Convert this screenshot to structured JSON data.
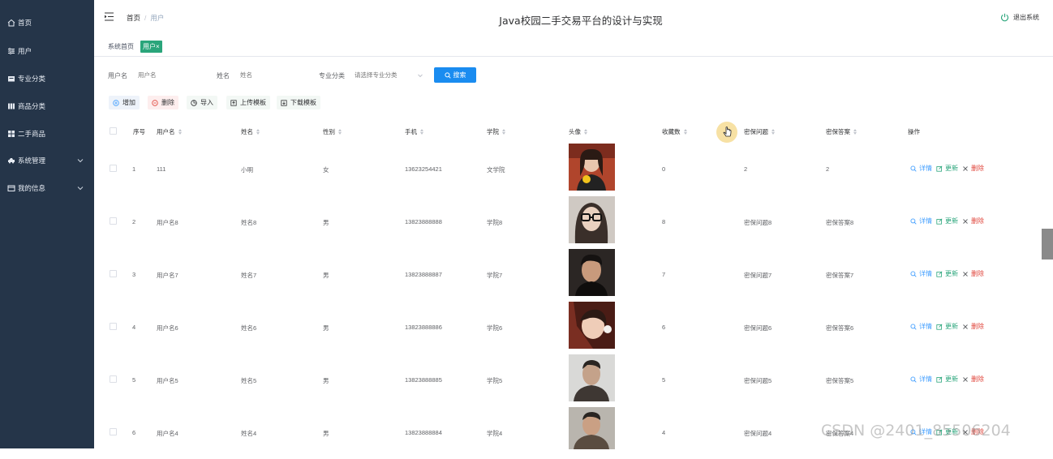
{
  "sidebar": {
    "items": [
      {
        "label": "首页",
        "icon": "home-icon"
      },
      {
        "label": "用户",
        "icon": "filter-icon"
      },
      {
        "label": "专业分类",
        "icon": "folder-icon"
      },
      {
        "label": "商品分类",
        "icon": "grid-icon"
      },
      {
        "label": "二手商品",
        "icon": "apps-icon"
      },
      {
        "label": "系统管理",
        "icon": "car-icon"
      },
      {
        "label": "我的信息",
        "icon": "card-icon"
      }
    ]
  },
  "header": {
    "breadcrumb_home": "首页",
    "breadcrumb_sep": "/",
    "breadcrumb_current": "用户",
    "title": "Java校园二手交易平台的设计与实现",
    "logout": "退出系统"
  },
  "tags": {
    "home": "系统首页",
    "active": "用户",
    "close": "×"
  },
  "search": {
    "username_label": "用户名",
    "username_placeholder": "用户名",
    "name_label": "姓名",
    "name_placeholder": "姓名",
    "major_label": "专业分类",
    "major_placeholder": "请选择专业分类",
    "button": "搜索"
  },
  "actions": {
    "add": "增加",
    "delete": "删除",
    "import": "导入",
    "upload": "上传模板",
    "download": "下载模板"
  },
  "table": {
    "headers": {
      "index": "序号",
      "username": "用户名",
      "name": "姓名",
      "gender": "性别",
      "phone": "手机",
      "college": "学院",
      "avatar": "头像",
      "favorites": "收藏数",
      "question": "密保问题",
      "answer": "密保答案",
      "ops": "操作"
    },
    "op_labels": {
      "detail": "详情",
      "update": "更新",
      "delete": "删除"
    },
    "rows": [
      {
        "index": "1",
        "username": "111",
        "name": "小明",
        "gender": "女",
        "phone": "13623254421",
        "college": "文学院",
        "favorites": "0",
        "question": "2",
        "answer": "2"
      },
      {
        "index": "2",
        "username": "用户名8",
        "name": "姓名8",
        "gender": "男",
        "phone": "13823888888",
        "college": "学院8",
        "favorites": "8",
        "question": "密保问题8",
        "answer": "密保答案8"
      },
      {
        "index": "3",
        "username": "用户名7",
        "name": "姓名7",
        "gender": "男",
        "phone": "13823888887",
        "college": "学院7",
        "favorites": "7",
        "question": "密保问题7",
        "answer": "密保答案7"
      },
      {
        "index": "4",
        "username": "用户名6",
        "name": "姓名6",
        "gender": "男",
        "phone": "13823888886",
        "college": "学院6",
        "favorites": "6",
        "question": "密保问题6",
        "answer": "密保答案6"
      },
      {
        "index": "5",
        "username": "用户名5",
        "name": "姓名5",
        "gender": "男",
        "phone": "13823888885",
        "college": "学院5",
        "favorites": "5",
        "question": "密保问题5",
        "answer": "密保答案5"
      },
      {
        "index": "6",
        "username": "用户名4",
        "name": "姓名4",
        "gender": "男",
        "phone": "13823888884",
        "college": "学院4",
        "favorites": "4",
        "question": "密保问题4",
        "answer": "密保答案4"
      }
    ]
  },
  "watermark": "CSDN @2401_85506204",
  "colors": {
    "sidebar": "#253549",
    "accent_green": "#2aa57b",
    "accent_blue": "#1a8cf0",
    "danger": "#e0463c"
  }
}
